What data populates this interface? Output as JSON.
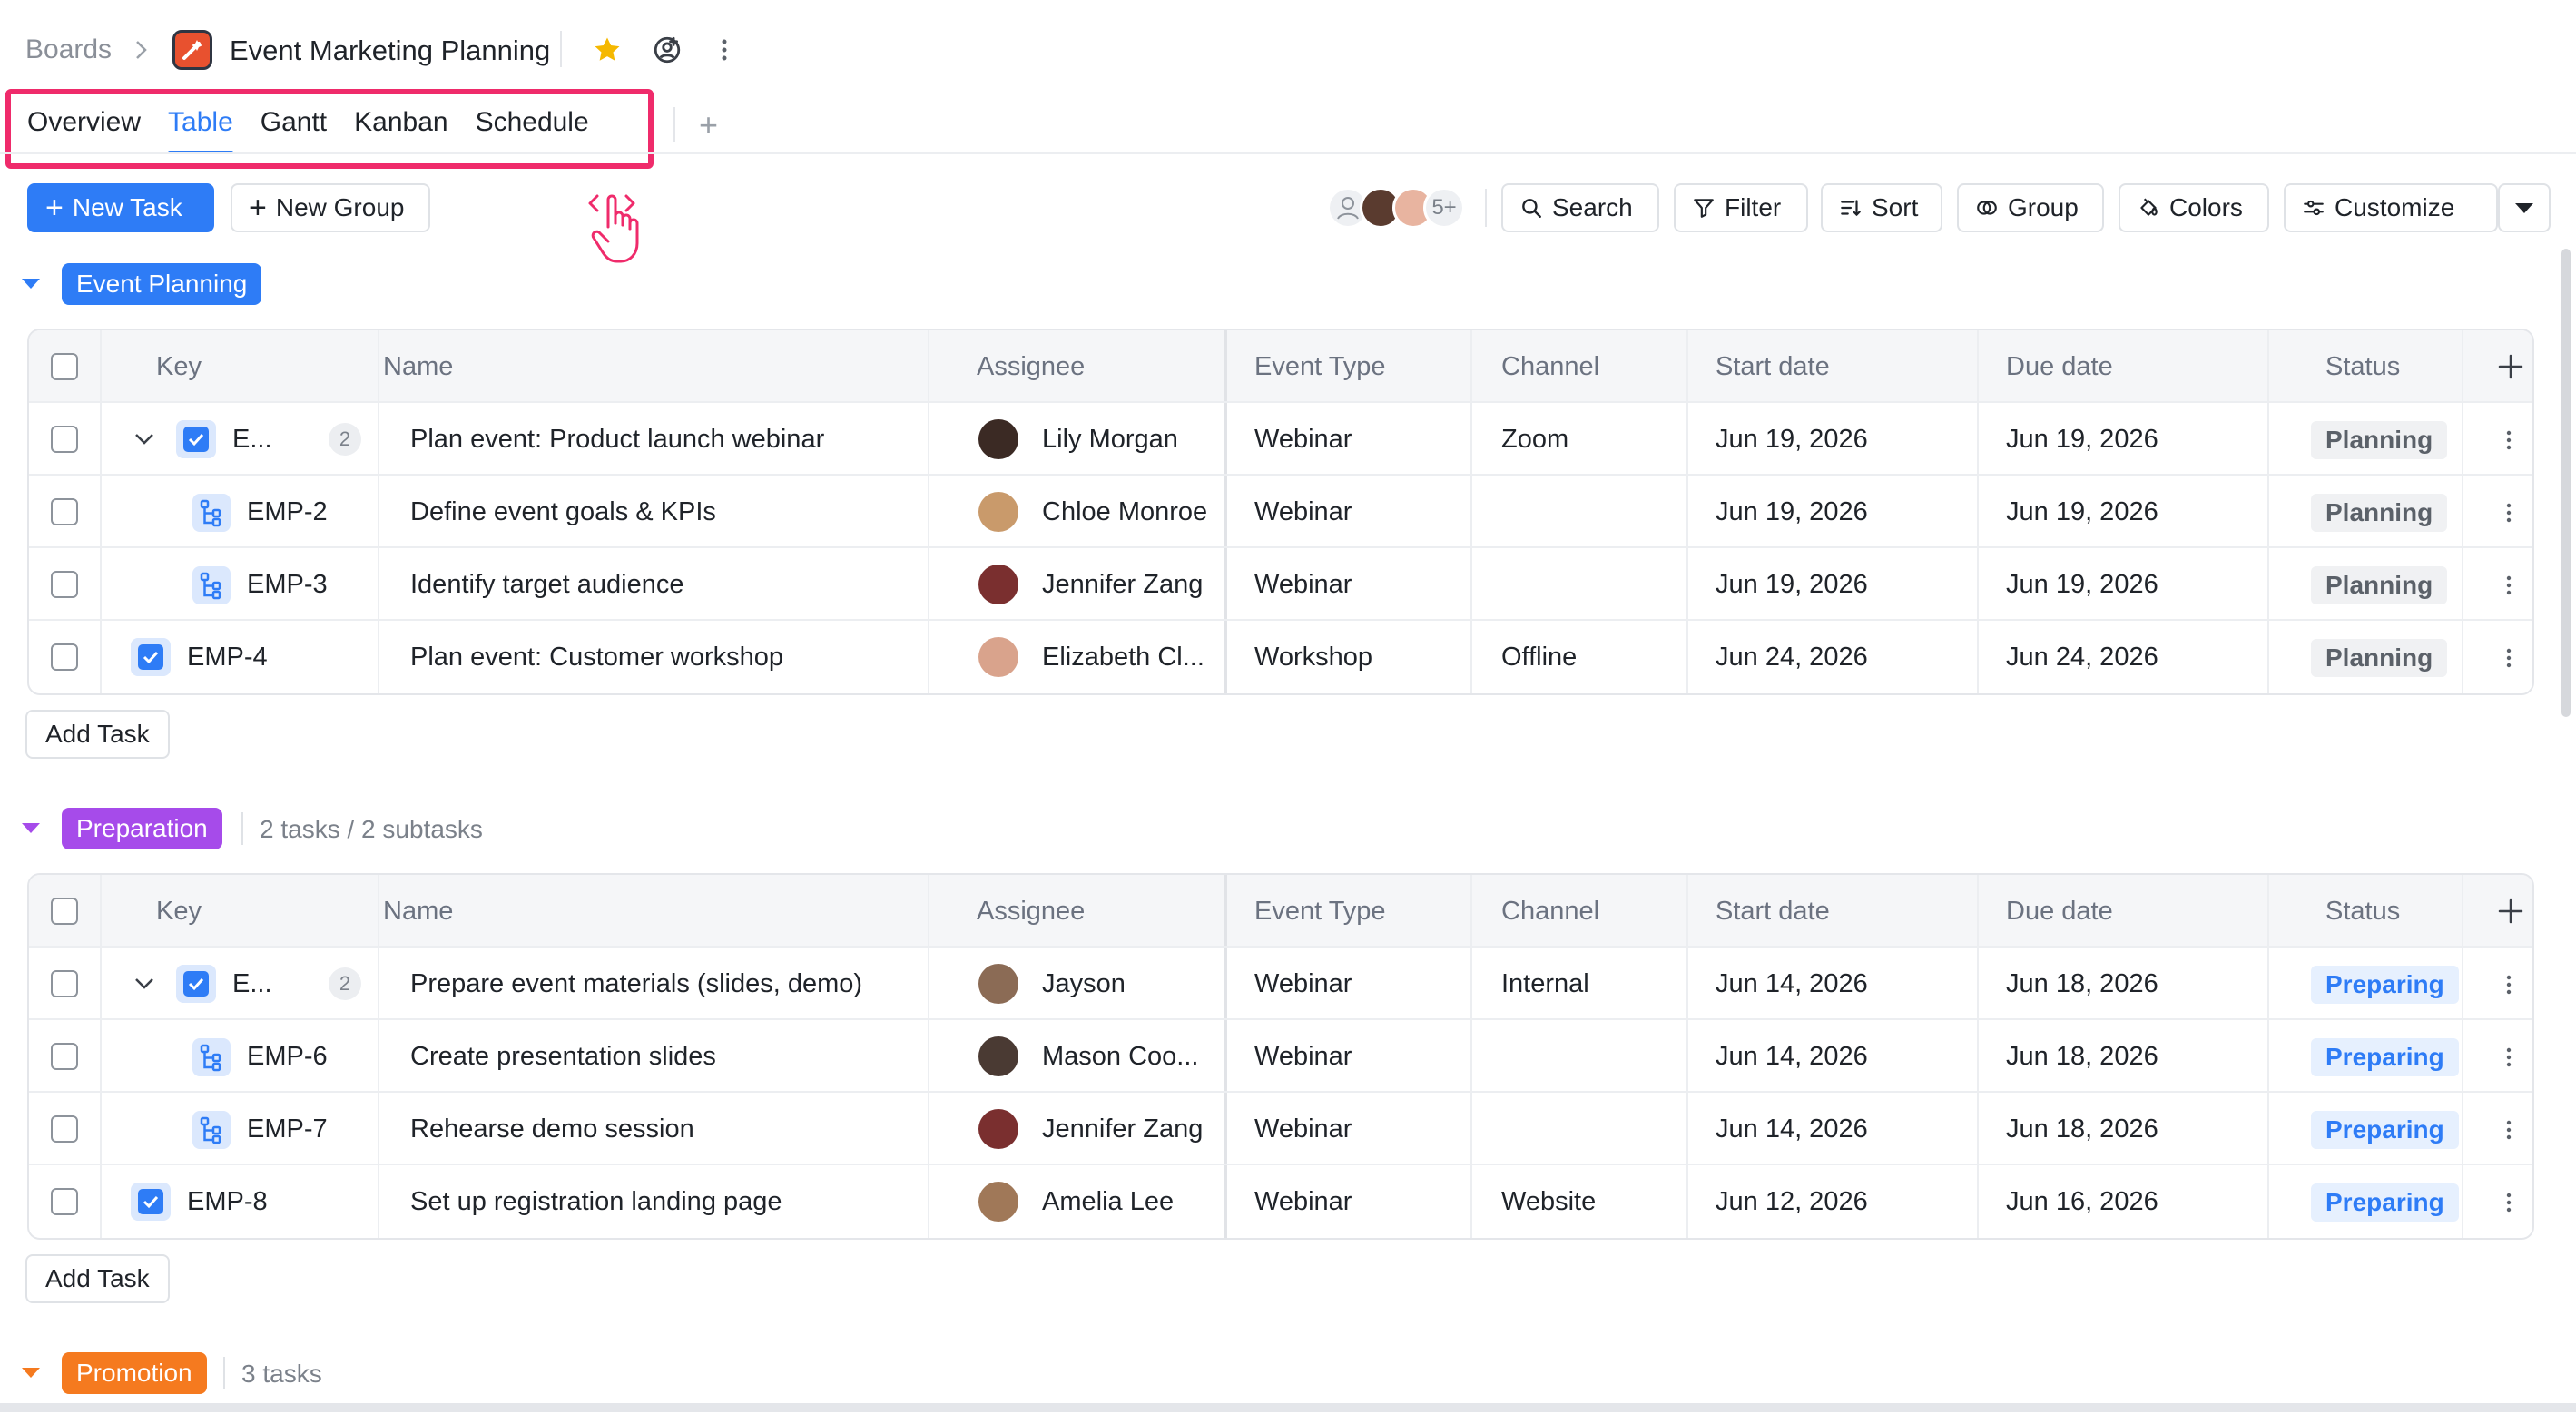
{
  "breadcrumb": {
    "root": "Boards",
    "board_title": "Event Marketing Planning"
  },
  "tabs": [
    {
      "label": "Overview",
      "active": false
    },
    {
      "label": "Table",
      "active": true
    },
    {
      "label": "Gantt",
      "active": false
    },
    {
      "label": "Kanban",
      "active": false
    },
    {
      "label": "Schedule",
      "active": false
    }
  ],
  "toolbar": {
    "new_task": "New Task",
    "new_group": "New Group",
    "avatars_more": "5+",
    "search": "Search",
    "filter": "Filter",
    "sort": "Sort",
    "group": "Group",
    "colors": "Colors",
    "customize": "Customize"
  },
  "columns": [
    "Key",
    "Name",
    "Assignee",
    "Event Type",
    "Channel",
    "Start date",
    "Due date",
    "Status"
  ],
  "add_task_label": "Add Task",
  "groups": [
    {
      "name": "Event Planning",
      "color": "#2e7cf6",
      "meta": "",
      "rows": [
        {
          "key": "E...",
          "count": "2",
          "level": "parent",
          "name": "Plan event: Product launch webinar",
          "assignee": "Lily Morgan",
          "event_type": "Webinar",
          "channel": "Zoom",
          "start": "Jun 19, 2026",
          "due": "Jun 19, 2026",
          "status": "Planning"
        },
        {
          "key": "EMP-2",
          "level": "sub",
          "name": "Define event goals & KPIs",
          "assignee": "Chloe Monroe",
          "event_type": "Webinar",
          "channel": "",
          "start": "Jun 19, 2026",
          "due": "Jun 19, 2026",
          "status": "Planning"
        },
        {
          "key": "EMP-3",
          "level": "sub",
          "name": "Identify target audience",
          "assignee": "Jennifer Zang",
          "event_type": "Webinar",
          "channel": "",
          "start": "Jun 19, 2026",
          "due": "Jun 19, 2026",
          "status": "Planning"
        },
        {
          "key": "EMP-4",
          "level": "task",
          "name": "Plan event: Customer workshop",
          "assignee": "Elizabeth Cl...",
          "event_type": "Workshop",
          "channel": "Offline",
          "start": "Jun 24, 2026",
          "due": "Jun 24, 2026",
          "status": "Planning"
        }
      ]
    },
    {
      "name": "Preparation",
      "color": "#a64bea",
      "meta": "2 tasks / 2 subtasks",
      "rows": [
        {
          "key": "E...",
          "count": "2",
          "level": "parent",
          "name": "Prepare event materials (slides, demo)",
          "assignee": "Jayson",
          "event_type": "Webinar",
          "channel": "Internal",
          "start": "Jun 14, 2026",
          "due": "Jun 18, 2026",
          "status": "Preparing"
        },
        {
          "key": "EMP-6",
          "level": "sub",
          "name": "Create presentation slides",
          "assignee": "Mason Coo...",
          "event_type": "Webinar",
          "channel": "",
          "start": "Jun 14, 2026",
          "due": "Jun 18, 2026",
          "status": "Preparing"
        },
        {
          "key": "EMP-7",
          "level": "sub",
          "name": "Rehearse demo session",
          "assignee": "Jennifer Zang",
          "event_type": "Webinar",
          "channel": "",
          "start": "Jun 14, 2026",
          "due": "Jun 18, 2026",
          "status": "Preparing"
        },
        {
          "key": "EMP-8",
          "level": "task",
          "name": "Set up registration landing page",
          "assignee": "Amelia Lee",
          "event_type": "Webinar",
          "channel": "Website",
          "start": "Jun 12, 2026",
          "due": "Jun 16, 2026",
          "status": "Preparing"
        }
      ]
    },
    {
      "name": "Promotion",
      "color": "#f57a1f",
      "meta": "3 tasks",
      "rows": []
    }
  ]
}
